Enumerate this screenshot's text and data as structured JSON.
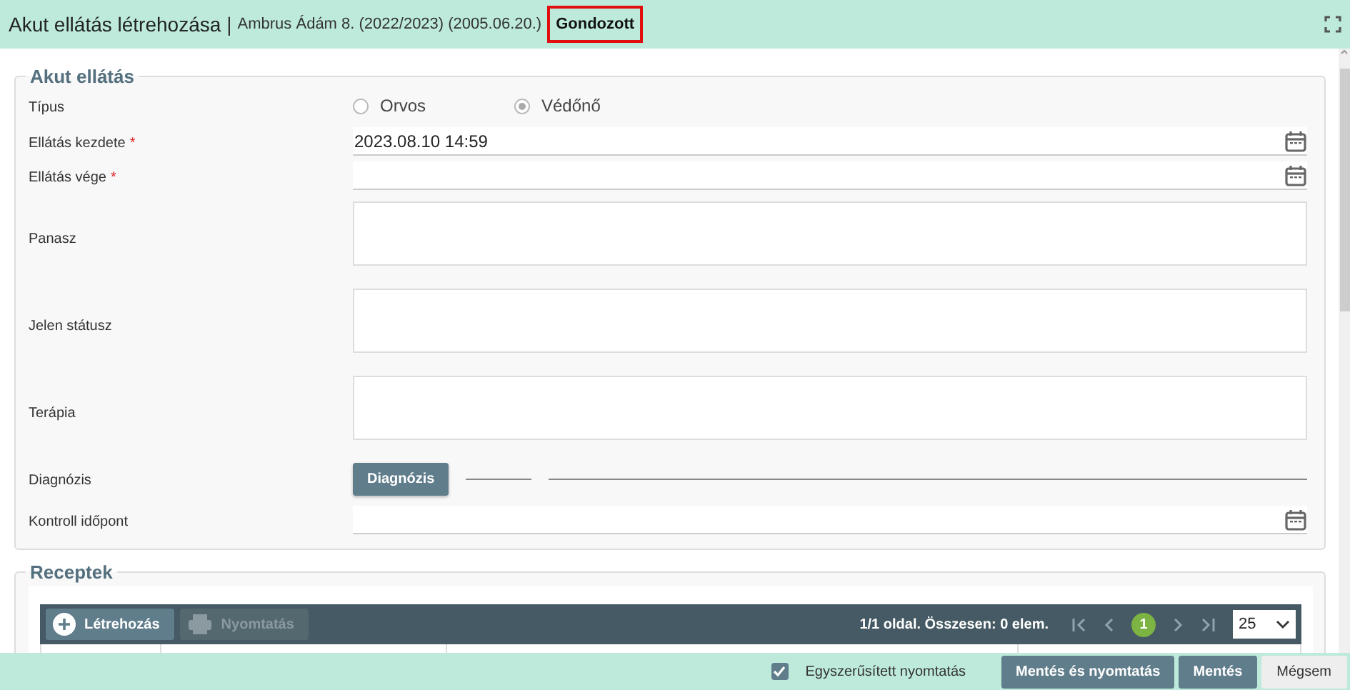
{
  "header": {
    "title": "Akut ellátás létrehozása",
    "separator": "|",
    "patient": "Ambrus Ádám 8. (2022/2023) (2005.06.20.)",
    "status": "Gondozott",
    "status_highlighted": true
  },
  "form": {
    "title": "Akut ellátás",
    "fields": [
      {
        "kind": "radio",
        "label": "Típus",
        "options": [
          {
            "label": "Orvos",
            "selected": false
          },
          {
            "label": "Védőnő",
            "selected": true
          }
        ]
      },
      {
        "kind": "datetime",
        "label": "Ellátás kezdete",
        "marker": "*",
        "value": "2023.08.10 14:59"
      },
      {
        "kind": "datetime",
        "label": "Ellátás vége",
        "marker": "*"
      },
      {
        "kind": "textarea",
        "label": "Panasz"
      },
      {
        "kind": "textarea",
        "label": "Jelen státusz"
      },
      {
        "kind": "textarea",
        "label": "Terápia"
      },
      {
        "kind": "diagnosis",
        "label": "Diagnózis",
        "button": "Diagnózis"
      },
      {
        "kind": "datetime",
        "label": "Kontroll időpont"
      }
    ]
  },
  "recipes": {
    "title": "Receptek",
    "buttons": [
      {
        "label": "Létrehozás",
        "kind": "create",
        "disabled": false
      },
      {
        "label": "Nyomtatás",
        "kind": "print",
        "disabled": true
      }
    ],
    "paging_text": "1/1 oldal. Összesen: 0 elem.",
    "current_page": "1",
    "page_size": "25"
  },
  "footer": {
    "checkbox": {
      "label": "Egyszerűsített nyomtatás",
      "checked": true
    },
    "buttons": [
      {
        "label": "Mentés és nyomtatás",
        "kind": "primary"
      },
      {
        "label": "Mentés",
        "kind": "primary"
      },
      {
        "label": "Mégsem",
        "kind": "secondary"
      }
    ]
  }
}
